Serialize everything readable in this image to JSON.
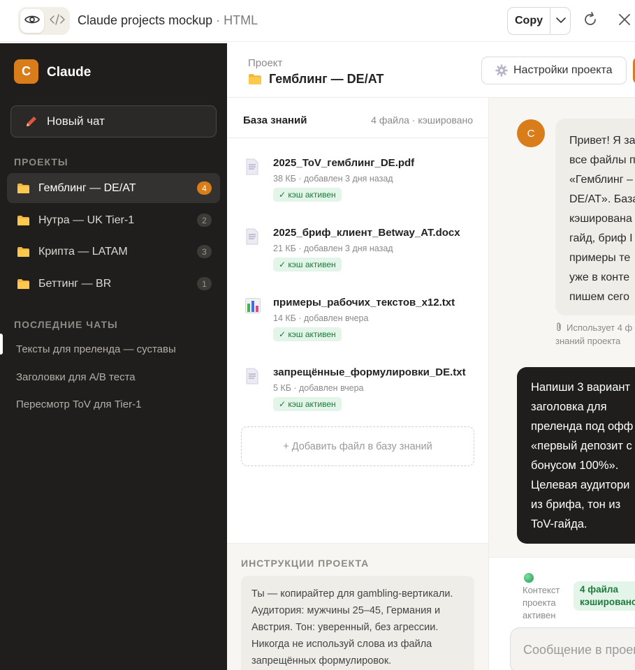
{
  "artifact": {
    "title": "Claude projects mockup",
    "type_label": "· HTML",
    "copy_label": "Copy"
  },
  "sidebar": {
    "logo_letter": "C",
    "brand": "Claude",
    "new_chat_label": "Новый чат",
    "projects_label": "ПРОЕКТЫ",
    "projects": [
      {
        "name": "Гемблинг — DE/AT",
        "count": "4",
        "active": true
      },
      {
        "name": "Нутра — UK Tier-1",
        "count": "2",
        "active": false
      },
      {
        "name": "Крипта — LATAM",
        "count": "3",
        "active": false
      },
      {
        "name": "Беттинг — BR",
        "count": "1",
        "active": false
      }
    ],
    "recent_label": "ПОСЛЕДНИЕ ЧАТЫ",
    "recent_chats": [
      "Тексты для преленда — суставы",
      "Заголовки для A/B теста",
      "Пересмотр ToV для Tier-1"
    ]
  },
  "header": {
    "crumb_small": "Проект",
    "project_title": "Гемблинг — DE/AT",
    "settings_label": "Настройки проекта"
  },
  "knowledge": {
    "title": "База знаний",
    "meta": "4 файла · кэшировано",
    "files": [
      {
        "name": "2025_ToV_гемблинг_DE.pdf",
        "meta": "38 КБ · добавлен 3 дня назад",
        "badge": "✓ кэш активен",
        "icon": "document-icon"
      },
      {
        "name": "2025_бриф_клиент_Betway_AT.docx",
        "meta": "21 КБ · добавлен 3 дня назад",
        "badge": "✓ кэш активен",
        "icon": "document-icon"
      },
      {
        "name": "примеры_рабочих_текстов_x12.txt",
        "meta": "14 КБ · добавлен вчера",
        "badge": "✓ кэш активен",
        "icon": "bar-chart-icon"
      },
      {
        "name": "запрещённые_формулировки_DE.txt",
        "meta": "5 КБ · добавлен вчера",
        "badge": "✓ кэш активен",
        "icon": "document-icon"
      }
    ],
    "add_file_label": "+ Добавить файл в базу знаний"
  },
  "instructions": {
    "label": "ИНСТРУКЦИИ ПРОЕКТА",
    "text": "Ты — копирайтер для gambling-вертикали. Аудитория: мужчины 25–45, Германия и Австрия. Тон: уверенный, без агрессии. Никогда не используй слова из файла запрещённых формулировок."
  },
  "chat": {
    "avatar_letter": "C",
    "bot_lines": [
      "Привет! Я за",
      "все файлы п",
      "«Гемблинг –",
      "DE/AT». База",
      "кэширована",
      "гайд, бриф I",
      "примеры те",
      "уже в конте",
      "пишем сего"
    ],
    "uses_lines": [
      "Использует 4 ф",
      "знаний проекта"
    ],
    "user_lines": [
      "Напиши 3 вариант",
      "заголовка для",
      "преленда под офф",
      "«первый депозит с",
      "бонусом 100%».",
      "Целевая аудитори",
      "из брифа, тон из",
      "ToV-гайда."
    ]
  },
  "composer": {
    "ctx_lines": [
      "Контекст",
      "проекта",
      "активен"
    ],
    "badge_lines": [
      "4 файла",
      "кэшировано"
    ],
    "placeholder": "Сообщение в проект"
  },
  "colors": {
    "accent": "#d97c1a",
    "sidebar_bg": "#1f1e1d",
    "success": "#1d7a3c",
    "success_bg": "#e3f4e8"
  }
}
